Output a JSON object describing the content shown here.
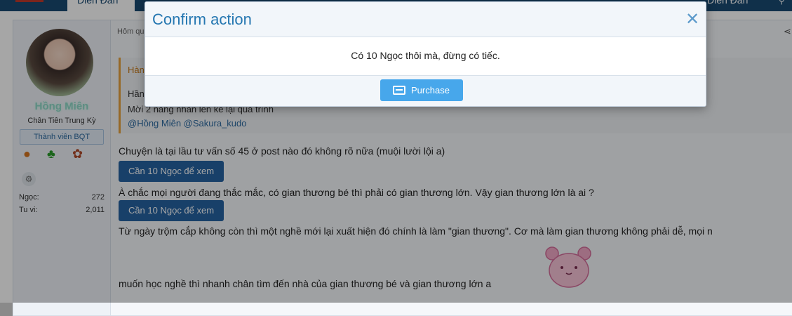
{
  "nav": {
    "active_tab": "Diễn Đàn",
    "right_tab": "Diễn Đàn"
  },
  "user": {
    "name": "Hồng Miên",
    "title": "Chân Tiên Trung Kỳ",
    "badge": "Thành viên BQT",
    "stats": [
      {
        "label": "Ngọc:",
        "value": "272"
      },
      {
        "label": "Tu vi:",
        "value": "2,011"
      }
    ]
  },
  "post": {
    "meta": "Hôm qu",
    "quote": {
      "head": "Hàn",
      "line1": "Hần",
      "line2": "Mời 2 nàng nhàn lên kể lại quá trình",
      "line3": "@Hồng Miên @Sakura_kudo"
    },
    "lines": [
      "Chuyện là tại lầu tư vấn số 45 ở post nào đó không rõ nữa (muội lười lội a)",
      "À chắc mọi người đang thắc mắc, có gian thương bé thì phải có gian thương lớn. Vậy gian thương lớn là ai ?",
      "Từ ngày trộm cắp không còn thì một nghề mới lại xuất hiện đó chính là làm \"gian thương\". Cơ mà làm gian thương không phải dễ, mọi n",
      "muốn học nghề thì nhanh chân tìm đến nhà của gian thương bé và gian thương lớn a"
    ],
    "locked_label": "Cần 10 Ngọc để xem"
  },
  "modal": {
    "title": "Confirm action",
    "message": "Có 10 Ngọc thôi mà, đừng có tiếc.",
    "button": "Purchase"
  },
  "colors": {
    "modal_title": "#2577b1",
    "primary_button": "#47a7eb",
    "locked_button": "#2563a1",
    "username": "#8fd9c8"
  }
}
